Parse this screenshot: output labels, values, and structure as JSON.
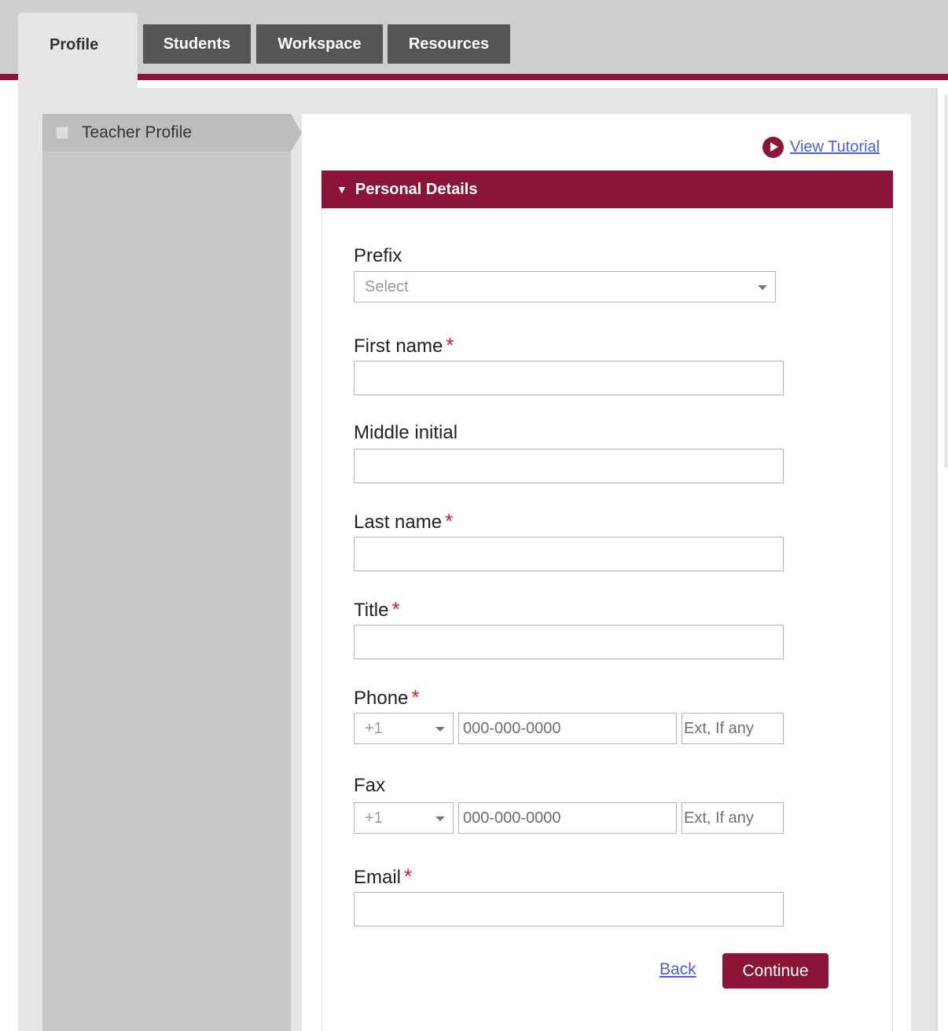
{
  "colors": {
    "accent": "#8a1538",
    "tab_dark": "#555555",
    "link": "#4b5fd6",
    "required": "#e8141c"
  },
  "tabs": [
    {
      "label": "Profile",
      "active": true
    },
    {
      "label": "Students",
      "active": false
    },
    {
      "label": "Workspace",
      "active": false
    },
    {
      "label": "Resources",
      "active": false
    }
  ],
  "sidebar": {
    "items": [
      {
        "label": "Teacher Profile",
        "checked": false
      }
    ]
  },
  "tutorial": {
    "label": "View Tutorial",
    "icon": "play-circle-icon"
  },
  "section": {
    "title": "Personal Details",
    "expanded": true
  },
  "form": {
    "prefix": {
      "label": "Prefix",
      "value": "Select"
    },
    "first_name": {
      "label": "First name",
      "required_mark": "*",
      "value": ""
    },
    "middle_initial": {
      "label": "Middle initial",
      "value": ""
    },
    "last_name": {
      "label": "Last name",
      "required_mark": "*",
      "value": ""
    },
    "title": {
      "label": "Title",
      "required_mark": "*",
      "value": ""
    },
    "phone": {
      "label": "Phone",
      "required_mark": "*",
      "country_code": "+1",
      "number_placeholder": "000-000-0000",
      "ext_placeholder": "Ext, If any"
    },
    "fax": {
      "label": "Fax",
      "country_code": "+1",
      "number_placeholder": "000-000-0000",
      "ext_placeholder": "Ext, If any"
    },
    "email": {
      "label": "Email",
      "required_mark": "*",
      "value": ""
    }
  },
  "actions": {
    "back_label": "Back",
    "continue_label": "Continue"
  }
}
